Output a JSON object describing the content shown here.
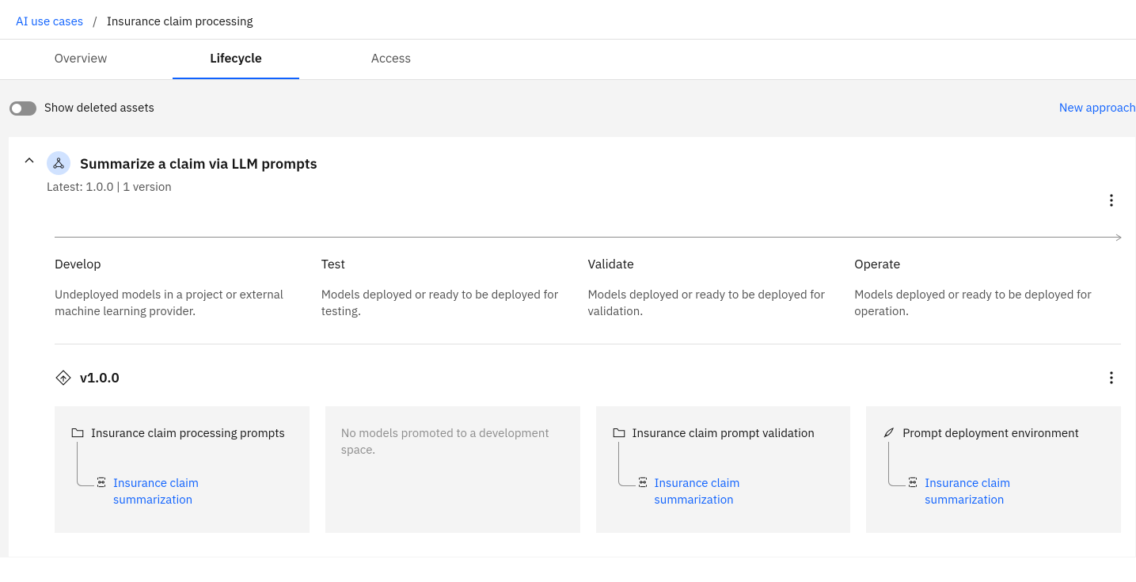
{
  "breadcrumb": {
    "root": "AI use cases",
    "current": "Insurance claim processing"
  },
  "tabs": [
    {
      "label": "Overview",
      "active": false
    },
    {
      "label": "Lifecycle",
      "active": true
    },
    {
      "label": "Access",
      "active": false
    }
  ],
  "toolbar": {
    "toggle_label": "Show deleted assets",
    "new_approach": "New approach"
  },
  "approach": {
    "title": "Summarize a claim via LLM prompts",
    "meta": "Latest: 1.0.0 | 1 version"
  },
  "stages": {
    "develop": {
      "title": "Develop",
      "desc": "Undeployed models in a project or external machine learning provider."
    },
    "test": {
      "title": "Test",
      "desc": "Models deployed or ready to be deployed for testing."
    },
    "validate": {
      "title": "Validate",
      "desc": "Models deployed or ready to be deployed for validation."
    },
    "operate": {
      "title": "Operate",
      "desc": "Models deployed or ready to be deployed for operation."
    }
  },
  "version": {
    "label": "v1.0.0"
  },
  "cards": {
    "develop": {
      "folder": "Insurance claim processing prompts",
      "link": "Insurance claim summarization"
    },
    "test": {
      "empty": "No models promoted to a development space."
    },
    "validate": {
      "folder": "Insurance claim prompt validation",
      "link": "Insurance claim summarization"
    },
    "operate": {
      "folder": "Prompt deployment environment",
      "link": "Insurance claim summarization"
    }
  }
}
